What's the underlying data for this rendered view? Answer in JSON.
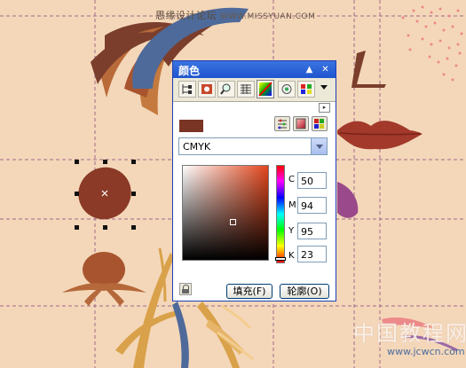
{
  "watermark_top": {
    "text": "思缘设计论坛",
    "url": "WWW.MISSYUAN.COM"
  },
  "watermark_bottom": {
    "text": "中国教程网",
    "url": "www.jcwcn.com"
  },
  "docker": {
    "title": "颜色",
    "tools": [
      "color-viewer-icon",
      "color-sliders-icon",
      "eyedropper-icon",
      "grid-icon",
      "color-blend-icon",
      "color-mixer-icon",
      "palettes-icon"
    ],
    "model": "CMYK",
    "swatch_color": "#7a3424",
    "cmyk": {
      "c": "50",
      "m": "94",
      "y": "95",
      "k": "23"
    },
    "labels": {
      "c": "C",
      "m": "M",
      "y": "Y",
      "k": "K"
    },
    "fill_button": "填充(F)",
    "outline_button": "轮廓(O)"
  },
  "colors": {
    "canvas": "#f4d7b9",
    "accent": "#1f55cf"
  }
}
